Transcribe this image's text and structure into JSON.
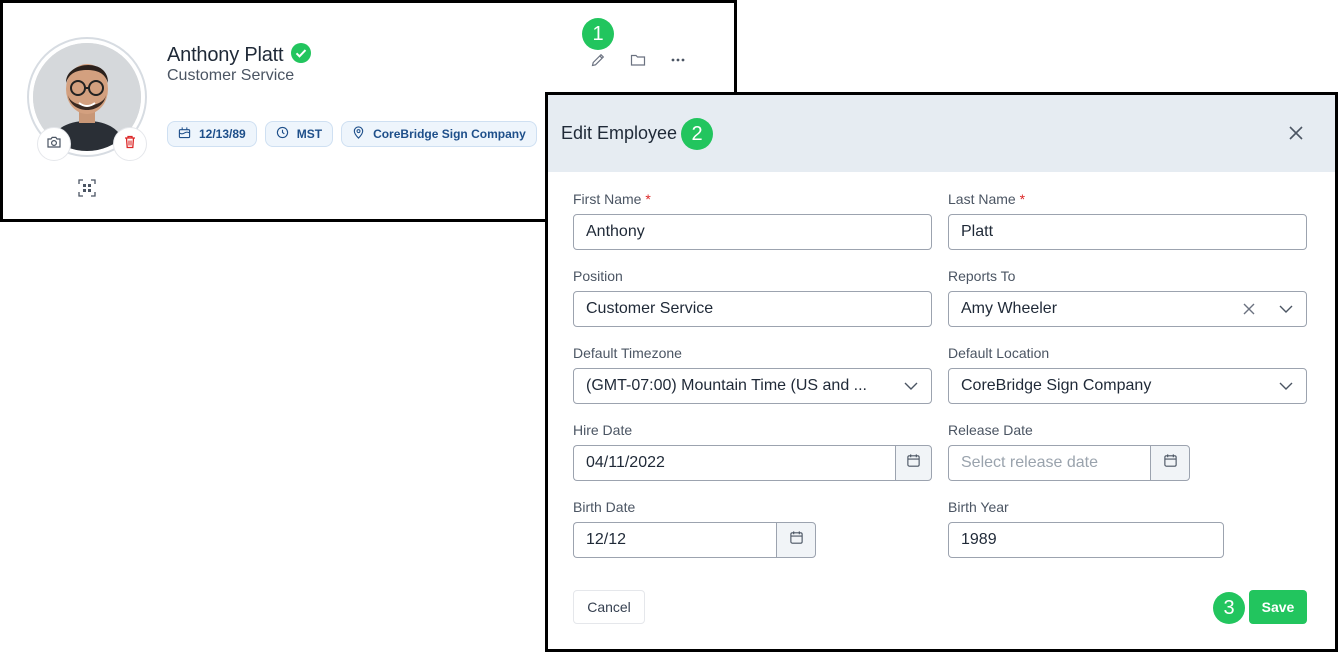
{
  "profile": {
    "name": "Anthony Platt",
    "title": "Customer Service",
    "chips": [
      {
        "icon": "calendar-icon",
        "label": "12/13/89"
      },
      {
        "icon": "clock-icon",
        "label": "MST"
      },
      {
        "icon": "location-pin-icon",
        "label": "CoreBridge Sign Company"
      }
    ],
    "actions": [
      "pencil-icon",
      "folder-icon",
      "more-icon"
    ]
  },
  "steps": [
    "1",
    "2",
    "3"
  ],
  "modal": {
    "title": "Edit Employee",
    "first_name_label": "First Name",
    "first_name_value": "Anthony",
    "last_name_label": "Last Name",
    "last_name_value": "Platt",
    "required_mark": "*",
    "position_label": "Position",
    "position_value": "Customer Service",
    "reports_to_label": "Reports To",
    "reports_to_value": "Amy Wheeler",
    "timezone_label": "Default Timezone",
    "timezone_value": "(GMT-07:00) Mountain Time (US and ...",
    "location_label": "Default Location",
    "location_value": "CoreBridge Sign Company",
    "hire_date_label": "Hire Date",
    "hire_date_value": "04/11/2022",
    "release_date_label": "Release Date",
    "release_date_placeholder": "Select release date",
    "birth_date_label": "Birth Date",
    "birth_date_value": "12/12",
    "birth_year_label": "Birth Year",
    "birth_year_value": "1989",
    "cancel_label": "Cancel",
    "save_label": "Save"
  },
  "colors": {
    "accent_green": "#22c55e",
    "chip_text": "#1e4f8a",
    "modal_header_bg": "#e6ecf2",
    "required": "#dc2626"
  }
}
